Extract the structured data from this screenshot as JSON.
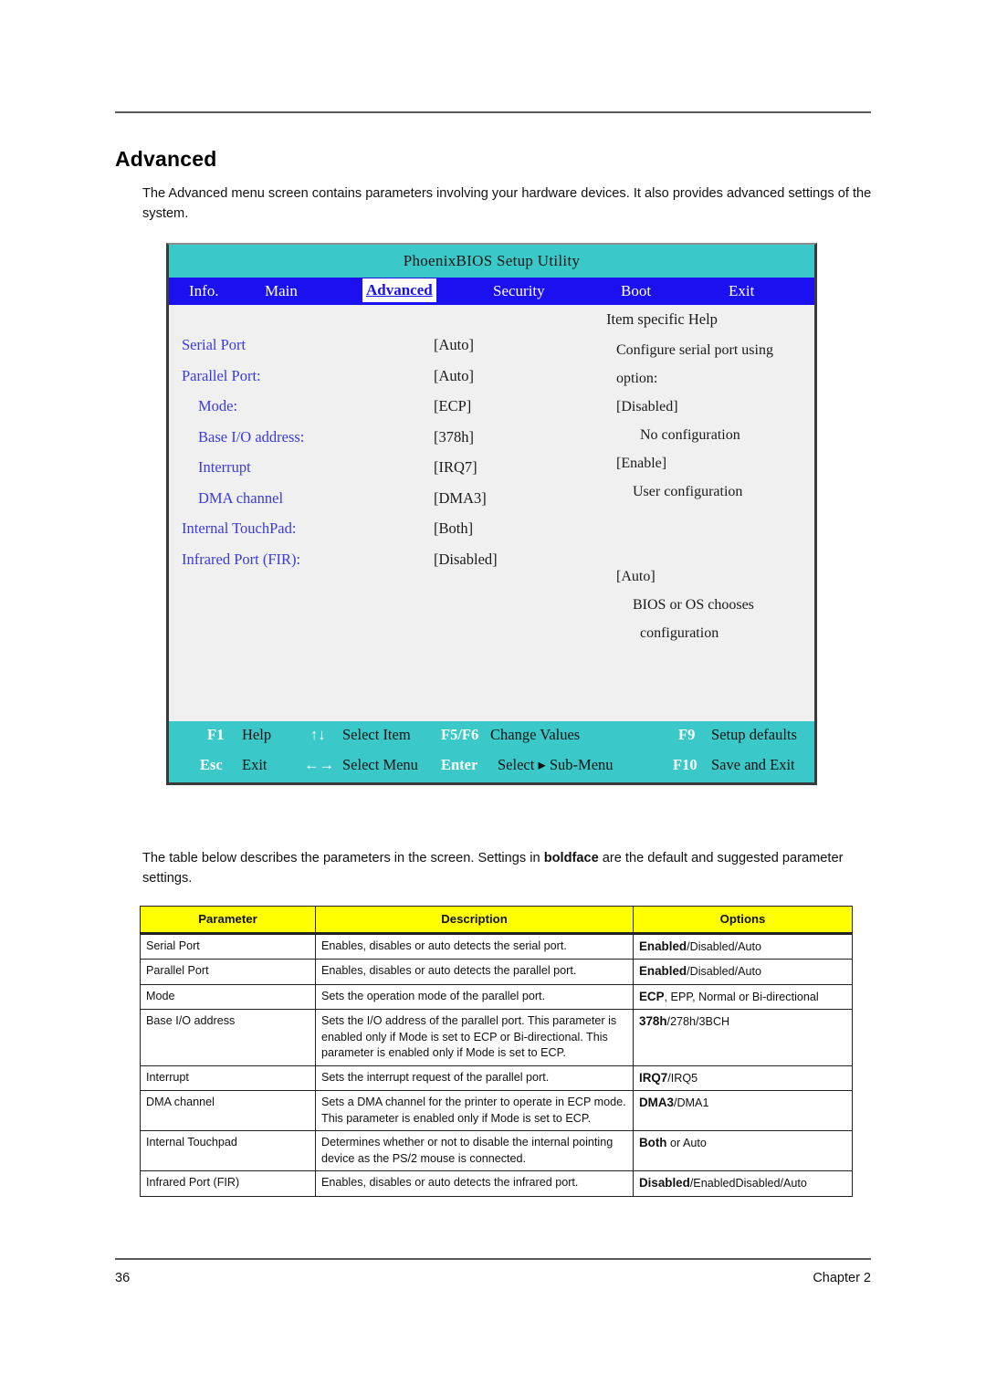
{
  "document": {
    "heading": "Advanced",
    "intro": "The Advanced menu screen contains parameters involving your hardware devices. It also provides advanced settings of the system.",
    "para2_before": "The table below describes the parameters in the screen. Settings in ",
    "para2_bold": "boldface",
    "para2_after": " are the default and suggested parameter settings.",
    "page_number": "36",
    "chapter": "Chapter 2"
  },
  "bios": {
    "title": "PhoenixBIOS Setup Utility",
    "menu": [
      {
        "label": "Info.",
        "active": false
      },
      {
        "label": "Main",
        "active": false
      },
      {
        "label": "Advanced",
        "active": true
      },
      {
        "label": "Security",
        "active": false
      },
      {
        "label": "Boot",
        "active": false
      },
      {
        "label": "Exit",
        "active": false
      }
    ],
    "help_title": "Item specific Help",
    "settings": [
      {
        "label": "Serial Port",
        "value": "[Auto]",
        "indent": false
      },
      {
        "label": "Parallel Port:",
        "value": "[Auto]",
        "indent": false
      },
      {
        "label": "Mode:",
        "value": "[ECP]",
        "indent": true
      },
      {
        "label": "Base I/O address:",
        "value": "[378h]",
        "indent": true
      },
      {
        "label": "Interrupt",
        "value": "[IRQ7]",
        "indent": true
      },
      {
        "label": "DMA channel",
        "value": "[DMA3]",
        "indent": true
      },
      {
        "label": "Internal TouchPad:",
        "value": "[Both]",
        "indent": false
      },
      {
        "label": "Infrared Port (FIR):",
        "value": "[Disabled]",
        "indent": false
      }
    ],
    "help_lines": [
      "Configure serial port using",
      "option:",
      "[Disabled]",
      "No configuration",
      "[Enable]",
      "User configuration",
      "[Auto]",
      "BIOS or OS chooses",
      "configuration"
    ],
    "footer": [
      {
        "key": "F1",
        "text": "Help"
      },
      {
        "key": "↑↓",
        "text": "Select Item"
      },
      {
        "key": "F5/F6",
        "text": "Change Values"
      },
      {
        "key": "F9",
        "text": "Setup defaults"
      },
      {
        "key": "Esc",
        "text": "Exit"
      },
      {
        "key": "←→",
        "text": "Select Menu"
      },
      {
        "key": "Enter",
        "text": "Select ▸ Sub-Menu"
      },
      {
        "key": "F10",
        "text": "Save and Exit"
      }
    ],
    "colors": {
      "title_bar": "#3ac8c8",
      "menu_bar": "#1a10f0",
      "body": "#f0f0f0",
      "label": "#3a3ae0"
    }
  },
  "table": {
    "headers": [
      "Parameter",
      "Description",
      "Options"
    ],
    "header_bg": "#ffff00",
    "rows": [
      {
        "parameter": "Serial Port",
        "description": "Enables, disables or auto detects the serial port.",
        "options_bold": "Enabled",
        "options_rest": "/Disabled/Auto"
      },
      {
        "parameter": "Parallel Port",
        "description": "Enables, disables or auto detects the parallel port.",
        "options_bold": "Enabled",
        "options_rest": "/Disabled/Auto"
      },
      {
        "parameter": "Mode",
        "description": "Sets the operation mode of the parallel port.",
        "options_bold": "ECP",
        "options_rest": ", EPP, Normal or Bi-directional"
      },
      {
        "parameter": "Base I/O address",
        "description": "Sets the I/O address of the parallel port. This parameter is enabled only if Mode is set to ECP or Bi-directional. This parameter is enabled only if Mode is set to ECP.",
        "options_bold": "378h",
        "options_rest": "/278h/3BCH"
      },
      {
        "parameter": "Interrupt",
        "description": "Sets the interrupt request of the parallel port.",
        "options_bold": "IRQ7",
        "options_rest": "/IRQ5"
      },
      {
        "parameter": "DMA channel",
        "description": "Sets a DMA channel for the printer to operate in ECP mode. This parameter is enabled only if Mode is set to ECP.",
        "options_bold": "DMA3",
        "options_rest": "/DMA1"
      },
      {
        "parameter": "Internal Touchpad",
        "description": "Determines whether or not to disable the internal pointing device as the PS/2 mouse is connected.",
        "options_bold": "Both",
        "options_rest": " or Auto"
      },
      {
        "parameter": "Infrared Port (FIR)",
        "description": "Enables, disables or auto detects the infrared port.",
        "options_bold": "Disabled",
        "options_rest": "/EnabledDisabled/Auto"
      }
    ]
  }
}
